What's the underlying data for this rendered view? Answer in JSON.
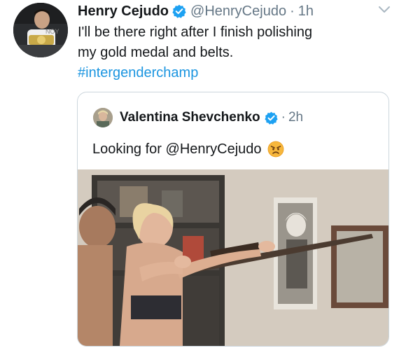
{
  "tweet": {
    "author_name": "Henry Cejudo",
    "author_handle": "@HenryCejudo",
    "separator": "·",
    "time": "1h",
    "text_line_1": "I'll be there right after I finish polishing",
    "text_line_2": "my gold medal and belts.",
    "hashtag": "#intergenderchamp",
    "avatar_icon": "avatar-henry-cejudo",
    "verified_icon": "verified-badge-icon",
    "menu_icon": "chevron-down-icon"
  },
  "quoted_tweet": {
    "author_name": "Valentina Shevchenko",
    "separator": "·",
    "time": "2h",
    "text": "Looking for @HenryCejudo",
    "emoji": "angry-face-emoji",
    "avatar_icon": "avatar-valentina-shevchenko",
    "verified_icon": "verified-badge-icon",
    "photo": "photo-woman-aiming-rifle"
  },
  "colors": {
    "text_primary": "#14171a",
    "text_secondary": "#657786",
    "link": "#1b95e0",
    "verified": "#1da1f2",
    "border": "#ccd6dd"
  }
}
